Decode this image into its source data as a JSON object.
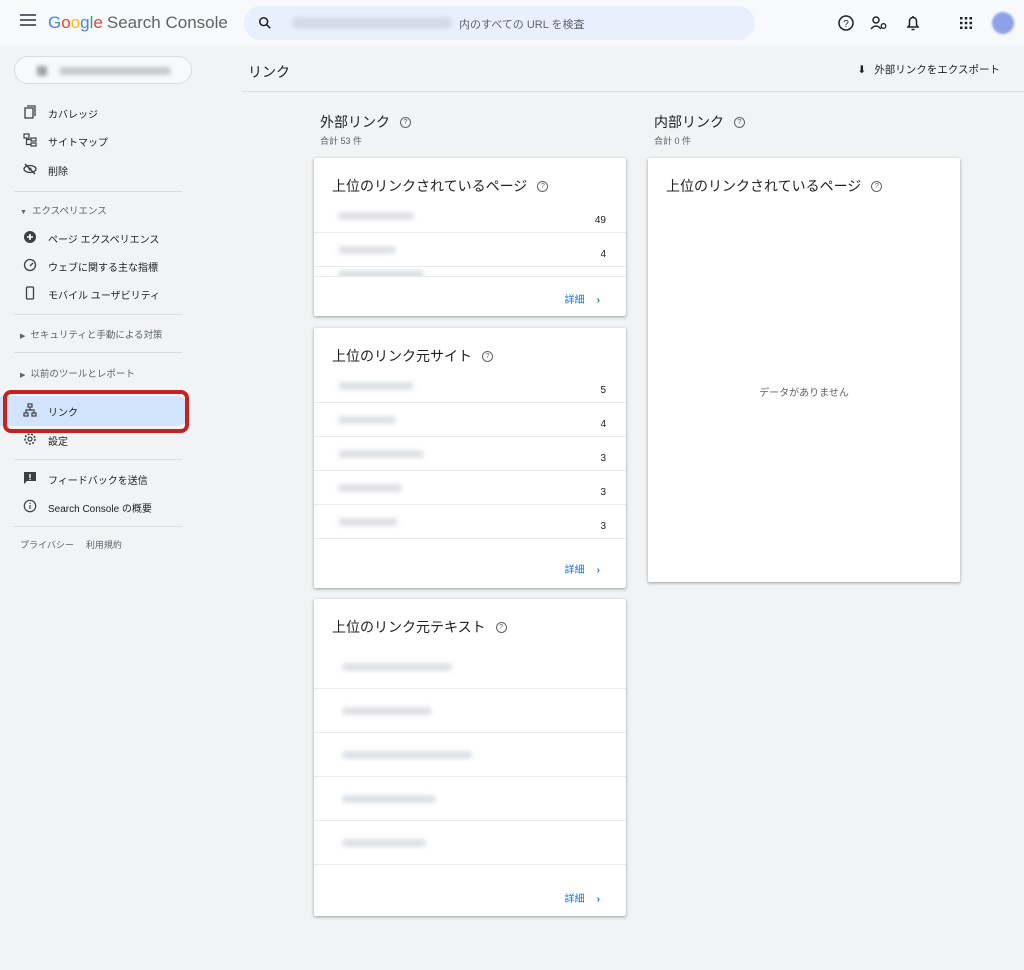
{
  "topbar": {
    "logo_letters": [
      "G",
      "o",
      "o",
      "g",
      "l",
      "e"
    ],
    "logo_rest": "Search Console",
    "search_placeholder": "内のすべての URL を検査"
  },
  "icons": {
    "menu": "menu-icon",
    "search": "search-icon",
    "help": "help-circle-icon",
    "users": "manage-users-icon",
    "bell": "notifications-icon",
    "apps": "apps-grid-icon"
  },
  "sidebar": {
    "items_top": [
      {
        "label": "カバレッジ",
        "icon": "coverage-icon"
      },
      {
        "label": "サイトマップ",
        "icon": "sitemap-icon"
      },
      {
        "label": "削除",
        "icon": "removals-icon"
      }
    ],
    "section_experience": "エクスペリエンス",
    "items_experience": [
      {
        "label": "ページ エクスペリエンス",
        "icon": "page-experience-icon"
      },
      {
        "label": "ウェブに関する主な指標",
        "icon": "core-web-vitals-icon"
      },
      {
        "label": "モバイル ユーザビリティ",
        "icon": "mobile-icon"
      }
    ],
    "section_security": "セキュリティと手動による対策",
    "section_legacy": "以前のツールとレポート",
    "items_bottom": [
      {
        "label": "リンク",
        "icon": "links-icon"
      },
      {
        "label": "設定",
        "icon": "settings-icon"
      }
    ],
    "items_footer": [
      {
        "label": "フィードバックを送信",
        "icon": "feedback-icon"
      },
      {
        "label": "Search Console の概要",
        "icon": "info-icon"
      }
    ],
    "footer_links": [
      "プライバシー",
      "利用規約"
    ]
  },
  "header": {
    "title": "リンク",
    "export_label": "外部リンクをエクスポート"
  },
  "external": {
    "title": "外部リンク",
    "subtitle": "合計 53 件",
    "top_pages": {
      "title": "上位のリンクされているページ",
      "values": [
        "49",
        "4",
        ""
      ],
      "details": "詳細"
    },
    "top_sites": {
      "title": "上位のリンク元サイト",
      "values": [
        "5",
        "4",
        "3",
        "3",
        "3"
      ],
      "details": "詳細"
    },
    "top_text": {
      "title": "上位のリンク元テキスト",
      "details": "詳細"
    }
  },
  "internal": {
    "title": "内部リンク",
    "subtitle": "合計 0 件",
    "top_pages": {
      "title": "上位のリンクされているページ",
      "empty": "データがありません"
    }
  },
  "colors": {
    "accent": "#1a73e8",
    "active": "#d2e3fc",
    "highlight": "#c5221f"
  }
}
